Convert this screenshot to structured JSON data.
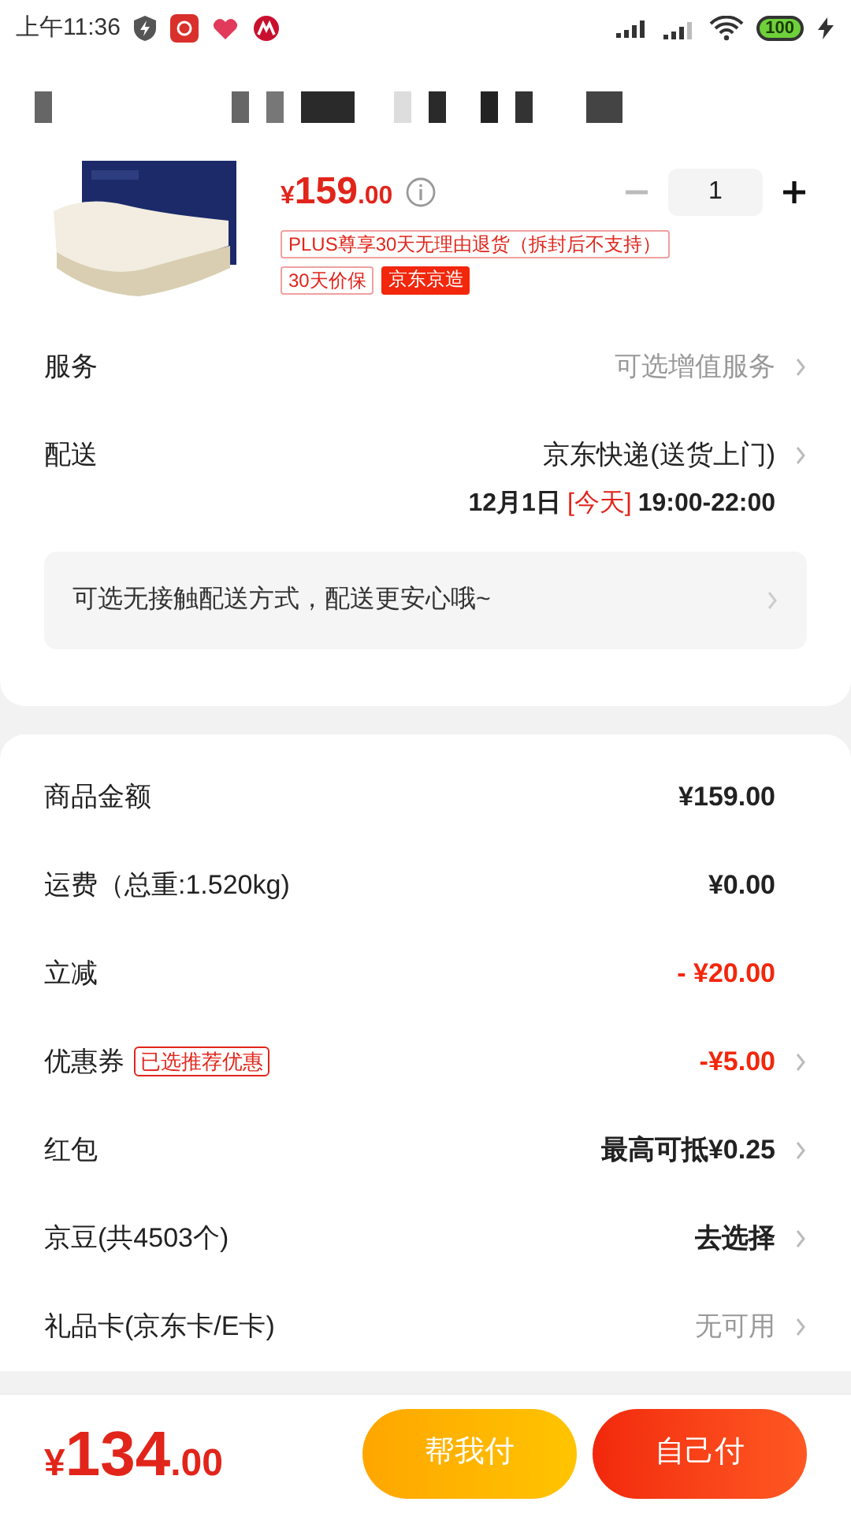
{
  "status_bar": {
    "time": "上午11:36",
    "battery": "100"
  },
  "product": {
    "price_symbol": "¥",
    "price_int": "159",
    "price_dec": ".00",
    "quantity": "1",
    "tags": [
      {
        "text": "PLUS尊享30天无理由退货（拆封后不支持）",
        "kind": "outline"
      },
      {
        "text": "30天价保",
        "kind": "outline"
      },
      {
        "text": "京东京造",
        "kind": "filled"
      }
    ]
  },
  "service": {
    "label": "服务",
    "value": "可选增值服务"
  },
  "delivery": {
    "label": "配送",
    "value": "京东快递(送货上门)",
    "date": "12月1日",
    "day": "[今天]",
    "time": "19:00-22:00"
  },
  "notice": "可选无接触配送方式，配送更安心哦~",
  "summary": [
    {
      "label": "商品金额",
      "value": "¥159.00",
      "kind": "plain",
      "arrow": false
    },
    {
      "label": "运费（总重:1.520kg)",
      "value": "¥0.00",
      "kind": "plain",
      "arrow": false
    },
    {
      "label": "立减",
      "value": "- ¥20.00",
      "kind": "discount",
      "arrow": false
    },
    {
      "label": "优惠券",
      "badge": "已选推荐优惠",
      "value": "-¥5.00",
      "kind": "discount",
      "arrow": true
    },
    {
      "label": "红包",
      "value": "最高可抵¥0.25",
      "kind": "plain",
      "arrow": true
    },
    {
      "label": "京豆(共4503个)",
      "value": "去选择",
      "kind": "plain",
      "arrow": true
    },
    {
      "label": "礼品卡(京东卡/E卡)",
      "value": "无可用",
      "kind": "muted",
      "arrow": true
    }
  ],
  "footer": {
    "symbol": "¥",
    "total_int": "134",
    "total_dec": ".00",
    "buttons": [
      {
        "label": "帮我付",
        "kind": "friend"
      },
      {
        "label": "自己付",
        "kind": "self"
      }
    ]
  }
}
